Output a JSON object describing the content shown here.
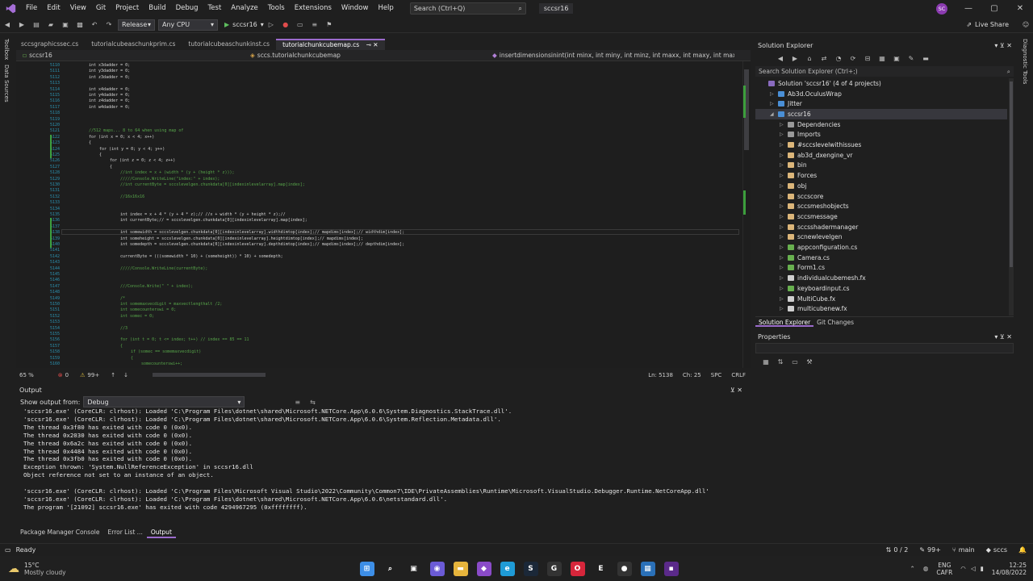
{
  "menu": {
    "items": [
      "File",
      "Edit",
      "View",
      "Git",
      "Project",
      "Build",
      "Debug",
      "Test",
      "Analyze",
      "Tools",
      "Extensions",
      "Window",
      "Help"
    ],
    "search_label": "Search (Ctrl+Q)",
    "solution_name": "sccsr16",
    "avatar_initials": "SC"
  },
  "toolbar": {
    "configuration": "Release",
    "platform": "Any CPU",
    "run_target": "sccsr16",
    "live_share": "Live Share"
  },
  "side_strips": {
    "left": [
      "Toolbox",
      "Data Sources"
    ],
    "right": [
      "Diagnostic Tools"
    ]
  },
  "editor": {
    "tabs": [
      {
        "label": "sccsgraphicssec.cs",
        "active": false
      },
      {
        "label": "tutorialcubeaschunkprim.cs",
        "active": false
      },
      {
        "label": "tutorialcubeaschunkinst.cs",
        "active": false
      },
      {
        "label": "tutorialchunkcubemap.cs",
        "active": true
      }
    ],
    "nav_project": "sccsr16",
    "nav_class": "sccs.tutorialchunkcubemap",
    "nav_member": "insertdimensionsinint(int minx, int miny, int minz, int maxx, int maxy, int max",
    "zoom": "65 %",
    "errors": "0",
    "warnings": "99+",
    "position": "Ln: 5138",
    "column": "Ch: 25",
    "spc": "SPC",
    "crlf": "CRLF",
    "lines": [
      {
        "n": "5110",
        "code": "int x3dadder = 0;",
        "cls": "tx",
        "indent": 90
      },
      {
        "n": "5111",
        "code": "int y3dadder = 0;",
        "cls": "tx",
        "indent": 90
      },
      {
        "n": "5112",
        "code": "int z3dadder = 0;",
        "cls": "tx",
        "indent": 90
      },
      {
        "n": "5113",
        "code": "",
        "cls": "tx",
        "indent": 90
      },
      {
        "n": "5114",
        "code": "int x4dadder = 0;",
        "cls": "tx",
        "indent": 90
      },
      {
        "n": "5115",
        "code": "int y4dadder = 0;",
        "cls": "tx",
        "indent": 90
      },
      {
        "n": "5116",
        "code": "int z4dadder = 0;",
        "cls": "tx",
        "indent": 90
      },
      {
        "n": "5117",
        "code": "int w4dadder = 0;",
        "cls": "tx",
        "indent": 90
      },
      {
        "n": "5118",
        "code": "",
        "cls": "tx",
        "indent": 90
      },
      {
        "n": "5119",
        "code": "",
        "cls": "tx",
        "indent": 90
      },
      {
        "n": "5120",
        "code": "",
        "cls": "tx",
        "indent": 90
      },
      {
        "n": "5121",
        "code": "//512 maps... 8 to 64 when using map of",
        "cls": "cm",
        "indent": 90
      },
      {
        "n": "5122",
        "code": "for (int x = 0; x < 4; x++)",
        "cls": "tx",
        "indent": 90
      },
      {
        "n": "5123",
        "code": "{",
        "cls": "tx",
        "indent": 90
      },
      {
        "n": "5124",
        "code": "for (int y = 0; y < 4; y++)",
        "cls": "tx",
        "indent": 103
      },
      {
        "n": "5125",
        "code": "{",
        "cls": "tx",
        "indent": 103
      },
      {
        "n": "5126",
        "code": "for (int z = 0; z < 4; z++)",
        "cls": "tx",
        "indent": 116
      },
      {
        "n": "5127",
        "code": "{",
        "cls": "tx",
        "indent": 116
      },
      {
        "n": "5128",
        "code": "//int index = x + (width * (y + (height * z)));",
        "cls": "cm",
        "indent": 129
      },
      {
        "n": "5129",
        "code": "/////Console.WriteLine(\"index:\" + index);",
        "cls": "cm",
        "indent": 129
      },
      {
        "n": "5130",
        "code": "//int currentByte = sccslevelgen.chunkdata[0][indexinlevelarray].map[index];",
        "cls": "cm",
        "indent": 129
      },
      {
        "n": "5131",
        "code": "",
        "cls": "tx",
        "indent": 129
      },
      {
        "n": "5132",
        "code": "//16x16x16",
        "cls": "cm",
        "indent": 129
      },
      {
        "n": "5133",
        "code": "",
        "cls": "tx",
        "indent": 129
      },
      {
        "n": "5134",
        "code": "",
        "cls": "tx",
        "indent": 129
      },
      {
        "n": "5135",
        "code": "int index = x + 4 * (y + 4 * z);// //x + width * (y + height * z);//",
        "cls": "tx",
        "indent": 129
      },
      {
        "n": "5136",
        "code": "int currentByte;// = sccslevelgen.chunkdata[0][indexinlevelarray].map[index];",
        "cls": "tx",
        "indent": 129
      },
      {
        "n": "5137",
        "code": "",
        "cls": "tx",
        "indent": 129
      },
      {
        "n": "5138",
        "code": "int somewidth = sccslevelgen.chunkdata[0][indexinlevelarray].widthdimtop[index];// mapdims[index];// widthdim[index];",
        "cls": "tx",
        "indent": 129
      },
      {
        "n": "5139",
        "code": "int someheight = sccslevelgen.chunkdata[0][indexinlevelarray].heightdimtop[index];// mapdims[index];",
        "cls": "tx",
        "indent": 129
      },
      {
        "n": "5140",
        "code": "int somedepth = sccslevelgen.chunkdata[0][indexinlevelarray].depthdimtop[index];// mapdims[index];// depthdim[index];",
        "cls": "tx",
        "indent": 129
      },
      {
        "n": "5141",
        "code": "",
        "cls": "tx",
        "indent": 129
      },
      {
        "n": "5142",
        "code": "currentByte = (((somewidth * 10) + (someheight)) * 10) + somedepth;",
        "cls": "tx",
        "indent": 129
      },
      {
        "n": "5143",
        "code": "",
        "cls": "tx",
        "indent": 129
      },
      {
        "n": "5144",
        "code": "/////Console.WriteLine(currentByte);",
        "cls": "cm",
        "indent": 129
      },
      {
        "n": "5145",
        "code": "",
        "cls": "tx",
        "indent": 129
      },
      {
        "n": "5146",
        "code": "",
        "cls": "tx",
        "indent": 129
      },
      {
        "n": "5147",
        "code": "///Console.Write(\" \" + index);",
        "cls": "cm",
        "indent": 129
      },
      {
        "n": "5148",
        "code": "",
        "cls": "tx",
        "indent": 129
      },
      {
        "n": "5149",
        "code": "/*",
        "cls": "cm",
        "indent": 129
      },
      {
        "n": "5150",
        "code": "int somemaxvecdigit = maxvectlengthalt /2;",
        "cls": "cm",
        "indent": 129
      },
      {
        "n": "5151",
        "code": "int somecounterswi = 0;",
        "cls": "cm",
        "indent": 129
      },
      {
        "n": "5152",
        "code": "int somec = 0;",
        "cls": "cm",
        "indent": 129
      },
      {
        "n": "5153",
        "code": "",
        "cls": "tx",
        "indent": 129
      },
      {
        "n": "5154",
        "code": "//3",
        "cls": "cm",
        "indent": 129
      },
      {
        "n": "5155",
        "code": "",
        "cls": "tx",
        "indent": 129
      },
      {
        "n": "5156",
        "code": "for (int t = 0; t <= index; t++) // index == 85 == 11",
        "cls": "cm",
        "indent": 129
      },
      {
        "n": "5157",
        "code": "{",
        "cls": "cm",
        "indent": 129
      },
      {
        "n": "5158",
        "code": "if (somec == somemaxvecdigit)",
        "cls": "cm",
        "indent": 142
      },
      {
        "n": "5159",
        "code": "{",
        "cls": "cm",
        "indent": 142
      },
      {
        "n": "5160",
        "code": "somecounterswi++;",
        "cls": "cm",
        "indent": 155
      }
    ]
  },
  "output": {
    "title": "Output",
    "show_from_label": "Show output from:",
    "show_from_value": "Debug",
    "lines": [
      "'sccsr16.exe' (CoreCLR: clrhost): Loaded 'C:\\Program Files\\dotnet\\shared\\Microsoft.NETCore.App\\6.0.6\\System.Diagnostics.StackTrace.dll'.",
      "'sccsr16.exe' (CoreCLR: clrhost): Loaded 'C:\\Program Files\\dotnet\\shared\\Microsoft.NETCore.App\\6.0.6\\System.Reflection.Metadata.dll'.",
      "The thread 0x3f80 has exited with code 0 (0x0).",
      "The thread 0x2030 has exited with code 0 (0x0).",
      "The thread 0x6a2c has exited with code 0 (0x0).",
      "The thread 0x4484 has exited with code 0 (0x0).",
      "The thread 0x3fb0 has exited with code 0 (0x0).",
      "Exception thrown: 'System.NullReferenceException' in sccsr16.dll",
      "Object reference not set to an instance of an object.",
      "",
      "'sccsr16.exe' (CoreCLR: clrhost): Loaded 'C:\\Program Files\\Microsoft Visual Studio\\2022\\Community\\Common7\\IDE\\PrivateAssemblies\\Runtime\\Microsoft.VisualStudio.Debugger.Runtime.NetCoreApp.dll'",
      "'sccsr16.exe' (CoreCLR: clrhost): Loaded 'C:\\Program Files\\dotnet\\shared\\Microsoft.NETCore.App\\6.0.6\\netstandard.dll'.",
      "The program '[21092] sccsr16.exe' has exited with code 4294967295 (0xffffffff)."
    ],
    "bottom_tabs": [
      "Package Manager Console",
      "Error List ...",
      "Output"
    ]
  },
  "solution_explorer": {
    "title": "Solution Explorer",
    "search_placeholder": "Search Solution Explorer (Ctrl+;)",
    "items": [
      {
        "label": "Solution 'sccsr16' (4 of 4 projects)",
        "depth": 0,
        "icon": "#8a6bbf",
        "selected": false
      },
      {
        "label": "Ab3d.OculusWrap",
        "depth": 1,
        "icon": "#4a8fd6",
        "selected": false
      },
      {
        "label": "Jitter",
        "depth": 1,
        "icon": "#4a8fd6",
        "selected": false
      },
      {
        "label": "sccsr16",
        "depth": 1,
        "icon": "#4a8fd6",
        "selected": true
      },
      {
        "label": "Dependencies",
        "depth": 2,
        "icon": "#9a9a9a",
        "selected": false
      },
      {
        "label": "Imports",
        "depth": 2,
        "icon": "#9a9a9a",
        "selected": false
      },
      {
        "label": "#sccslevelwithissues",
        "depth": 2,
        "icon": "#dcb67a",
        "selected": false
      },
      {
        "label": "ab3d_dxengine_vr",
        "depth": 2,
        "icon": "#dcb67a",
        "selected": false
      },
      {
        "label": "bin",
        "depth": 2,
        "icon": "#dcb67a",
        "selected": false
      },
      {
        "label": "Forces",
        "depth": 2,
        "icon": "#dcb67a",
        "selected": false
      },
      {
        "label": "obj",
        "depth": 2,
        "icon": "#dcb67a",
        "selected": false
      },
      {
        "label": "sccscore",
        "depth": 2,
        "icon": "#dcb67a",
        "selected": false
      },
      {
        "label": "sccsmeshobjects",
        "depth": 2,
        "icon": "#dcb67a",
        "selected": false
      },
      {
        "label": "sccsmessage",
        "depth": 2,
        "icon": "#dcb67a",
        "selected": false
      },
      {
        "label": "sccsshadermanager",
        "depth": 2,
        "icon": "#dcb67a",
        "selected": false
      },
      {
        "label": "scnewlevelgen",
        "depth": 2,
        "icon": "#dcb67a",
        "selected": false
      },
      {
        "label": "appconfiguration.cs",
        "depth": 2,
        "icon": "#68b04f",
        "selected": false
      },
      {
        "label": "Camera.cs",
        "depth": 2,
        "icon": "#68b04f",
        "selected": false
      },
      {
        "label": "Form1.cs",
        "depth": 2,
        "icon": "#68b04f",
        "selected": false
      },
      {
        "label": "individualcubemesh.fx",
        "depth": 2,
        "icon": "#cfcfcf",
        "selected": false
      },
      {
        "label": "keyboardinput.cs",
        "depth": 2,
        "icon": "#68b04f",
        "selected": false
      },
      {
        "label": "MultiCube.fx",
        "depth": 2,
        "icon": "#cfcfcf",
        "selected": false
      },
      {
        "label": "multicubenew.fx",
        "depth": 2,
        "icon": "#cfcfcf",
        "selected": false
      }
    ],
    "tabs": [
      "Solution Explorer",
      "Git Changes"
    ]
  },
  "properties": {
    "title": "Properties"
  },
  "statusbar": {
    "ready": "Ready",
    "updown": "0 / 2",
    "edits": "99+",
    "branch": "main",
    "repo": "sccs"
  },
  "taskbar": {
    "temperature": "15°C",
    "weather": "Mostly cloudy",
    "lang": "ENG",
    "region": "CAFR",
    "time": "12:25",
    "date": "14/08/2022",
    "apps": [
      {
        "name": "windows-start-icon",
        "glyph": "⊞",
        "color": "#3d8ee6"
      },
      {
        "name": "search-icon",
        "glyph": "⌕",
        "color": "#202020"
      },
      {
        "name": "task-view-icon",
        "glyph": "▣",
        "color": "#202020"
      },
      {
        "name": "chat-icon",
        "glyph": "◉",
        "color": "#6b5bd6"
      },
      {
        "name": "file-explorer-icon",
        "glyph": "▬",
        "color": "#e6b43c"
      },
      {
        "name": "visual-studio-icon",
        "glyph": "◆",
        "color": "#8a4bc8"
      },
      {
        "name": "edge-icon",
        "glyph": "e",
        "color": "#1f9bd6"
      },
      {
        "name": "steam-icon",
        "glyph": "S",
        "color": "#1b2838"
      },
      {
        "name": "github-icon",
        "glyph": "G",
        "color": "#333"
      },
      {
        "name": "opera-icon",
        "glyph": "O",
        "color": "#d6263b"
      },
      {
        "name": "epic-icon",
        "glyph": "E",
        "color": "#202020"
      },
      {
        "name": "obs-icon",
        "glyph": "●",
        "color": "#333"
      },
      {
        "name": "app-icon",
        "glyph": "▦",
        "color": "#2a70b8"
      },
      {
        "name": "terminal-icon",
        "glyph": "▪",
        "color": "#5b2a8a"
      }
    ]
  }
}
